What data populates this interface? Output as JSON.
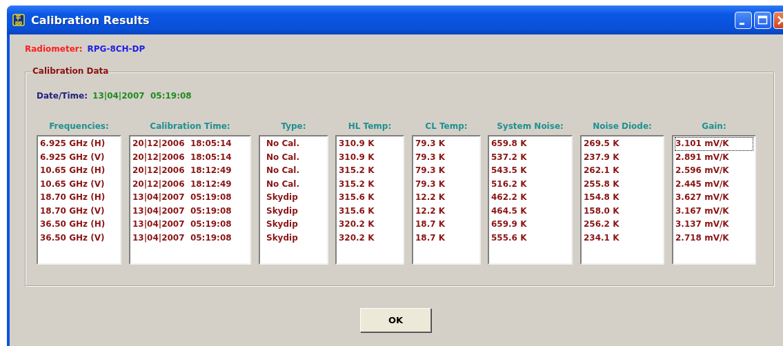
{
  "window": {
    "title": "Calibration Results"
  },
  "radiometer": {
    "label": "Radiometer:",
    "value": "RPG-8CH-DP"
  },
  "group": {
    "title": "Calibration Data",
    "date_time": {
      "label": "Date/Time:",
      "value": "13|04|2007  05:19:08"
    },
    "columns": [
      {
        "heading": "Frequencies:",
        "items": [
          {
            "text": "6.925 GHz (H)",
            "focused": false
          },
          {
            "text": "6.925 GHz (V)",
            "focused": false
          },
          {
            "text": "10.65 GHz (H)",
            "focused": false
          },
          {
            "text": "10.65 GHz (V)",
            "focused": false
          },
          {
            "text": "18.70 GHz (H)",
            "focused": false
          },
          {
            "text": "18.70 GHz (V)",
            "focused": false
          },
          {
            "text": "36.50 GHz (H)",
            "focused": false
          },
          {
            "text": "36.50 GHz (V)",
            "focused": false
          }
        ]
      },
      {
        "heading": "Calibration Time:",
        "items": [
          {
            "text": "20|12|2006  18:05:14",
            "focused": false
          },
          {
            "text": "20|12|2006  18:05:14",
            "focused": false
          },
          {
            "text": "20|12|2006  18:12:49",
            "focused": false
          },
          {
            "text": "20|12|2006  18:12:49",
            "focused": false
          },
          {
            "text": "13|04|2007  05:19:08",
            "focused": false
          },
          {
            "text": "13|04|2007  05:19:08",
            "focused": false
          },
          {
            "text": "13|04|2007  05:19:08",
            "focused": false
          },
          {
            "text": "13|04|2007  05:19:08",
            "focused": false
          }
        ]
      },
      {
        "heading": "Type:",
        "items": [
          {
            "text": "No Cal.",
            "focused": false
          },
          {
            "text": "No Cal.",
            "focused": false
          },
          {
            "text": "No Cal.",
            "focused": false
          },
          {
            "text": "No Cal.",
            "focused": false
          },
          {
            "text": "Skydip",
            "focused": false
          },
          {
            "text": "Skydip",
            "focused": false
          },
          {
            "text": "Skydip",
            "focused": false
          },
          {
            "text": "Skydip",
            "focused": false
          }
        ]
      },
      {
        "heading": "HL Temp:",
        "items": [
          {
            "text": "310.9 K",
            "focused": false
          },
          {
            "text": "310.9 K",
            "focused": false
          },
          {
            "text": "315.2 K",
            "focused": false
          },
          {
            "text": "315.2 K",
            "focused": false
          },
          {
            "text": "315.6 K",
            "focused": false
          },
          {
            "text": "315.6 K",
            "focused": false
          },
          {
            "text": "320.2 K",
            "focused": false
          },
          {
            "text": "320.2 K",
            "focused": false
          }
        ]
      },
      {
        "heading": "CL Temp:",
        "items": [
          {
            "text": "79.3 K",
            "focused": false
          },
          {
            "text": "79.3 K",
            "focused": false
          },
          {
            "text": "79.3 K",
            "focused": false
          },
          {
            "text": "79.3 K",
            "focused": false
          },
          {
            "text": "12.2 K",
            "focused": false
          },
          {
            "text": "12.2 K",
            "focused": false
          },
          {
            "text": "18.7 K",
            "focused": false
          },
          {
            "text": "18.7 K",
            "focused": false
          }
        ]
      },
      {
        "heading": "System Noise:",
        "items": [
          {
            "text": "659.8 K",
            "focused": false
          },
          {
            "text": "537.2 K",
            "focused": false
          },
          {
            "text": "543.5 K",
            "focused": false
          },
          {
            "text": "516.2 K",
            "focused": false
          },
          {
            "text": "462.2 K",
            "focused": false
          },
          {
            "text": "464.5 K",
            "focused": false
          },
          {
            "text": "659.9 K",
            "focused": false
          },
          {
            "text": "555.6 K",
            "focused": false
          }
        ]
      },
      {
        "heading": "Noise Diode:",
        "items": [
          {
            "text": "269.5 K",
            "focused": false
          },
          {
            "text": "237.9 K",
            "focused": false
          },
          {
            "text": "262.1 K",
            "focused": false
          },
          {
            "text": "255.8 K",
            "focused": false
          },
          {
            "text": "154.8 K",
            "focused": false
          },
          {
            "text": "158.0 K",
            "focused": false
          },
          {
            "text": "256.2 K",
            "focused": false
          },
          {
            "text": "234.1 K",
            "focused": false
          }
        ]
      },
      {
        "heading": "Gain:",
        "items": [
          {
            "text": "3.101 mV/K",
            "focused": true
          },
          {
            "text": "2.891 mV/K",
            "focused": false
          },
          {
            "text": "2.596 mV/K",
            "focused": false
          },
          {
            "text": "2.445 mV/K",
            "focused": false
          },
          {
            "text": "3.627 mV/K",
            "focused": false
          },
          {
            "text": "3.167 mV/K",
            "focused": false
          },
          {
            "text": "3.137 mV/K",
            "focused": false
          },
          {
            "text": "2.718 mV/K",
            "focused": false
          }
        ]
      }
    ]
  },
  "buttons": [
    {
      "label": "OK"
    }
  ]
}
